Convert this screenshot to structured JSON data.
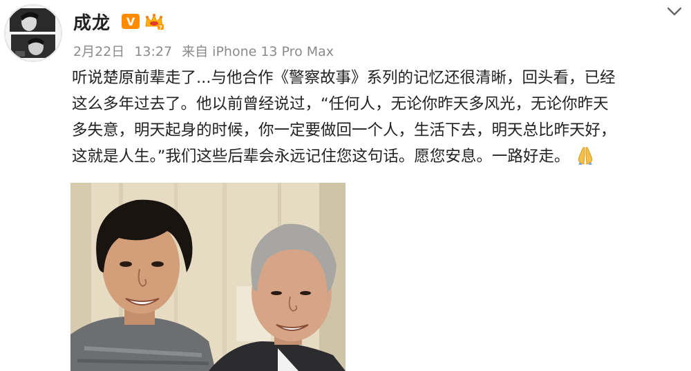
{
  "user": {
    "name": "成龙",
    "verified_badge": "V",
    "vip_badge_icon": "crown-vip-icon",
    "avatar_icon": "avatar-portrait-icon"
  },
  "meta": {
    "date": "2月22日",
    "time": "13:27",
    "source": "来自 iPhone 13 Pro Max"
  },
  "post": {
    "lines": [
      "听说楚原前辈走了...与他合作《警察故事》系列的记忆还很清晰，回头看，已经",
      "这么多年过去了。他以前曾经说过，“任何人，无论你昨天多风光，无论你昨天",
      "多失意，明天起身的时候，你一定要做回一个人，生活下去，明天总比昨天好，",
      "这就是人生。”我们这些后辈会永远记住您这句话。愿您安息。一路好走。"
    ],
    "trailing_emoji": "folded-hands-icon"
  },
  "menu": {
    "icon": "chevron-down-icon"
  },
  "photo": {
    "icon": "photo-two-men-icon"
  },
  "colors": {
    "text": "#222222",
    "meta": "#8a8a8a",
    "v_badge": "#ff8b00",
    "vip_gold": "#ffb300"
  }
}
